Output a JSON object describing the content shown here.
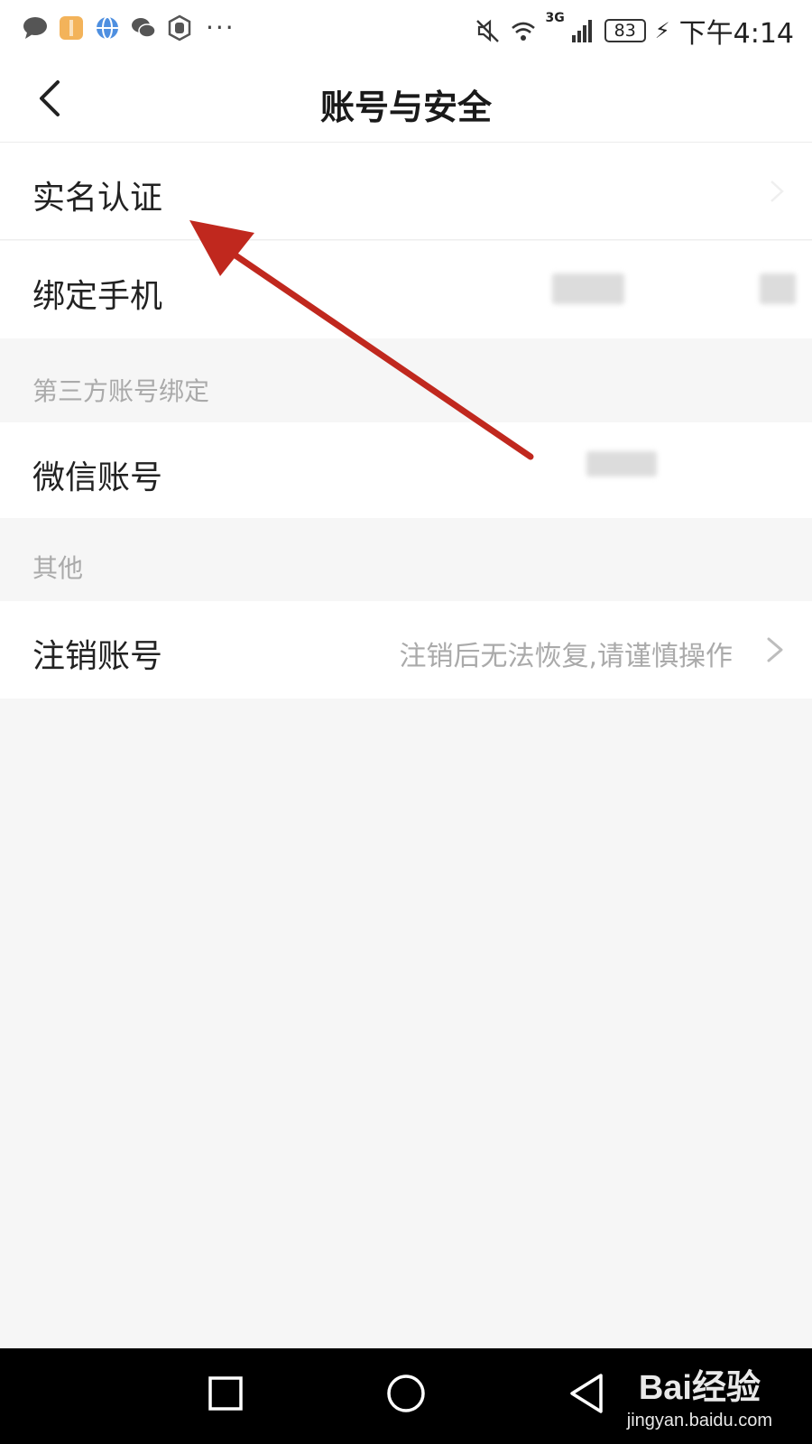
{
  "status_bar": {
    "time": "下午4:14",
    "battery": "83",
    "network": "3G",
    "more": "···"
  },
  "nav": {
    "title": "账号与安全"
  },
  "rows": {
    "realname": {
      "label": "实名认证"
    },
    "phone": {
      "label": "绑定手机"
    },
    "wechat": {
      "label": "微信账号"
    },
    "cancel": {
      "label": "注销账号",
      "hint": "注销后无法恢复,请谨慎操作"
    }
  },
  "sections": {
    "third_party": "第三方账号绑定",
    "other": "其他"
  },
  "watermark": {
    "logo": "Bai经验",
    "url": "jingyan.baidu.com"
  },
  "colors": {
    "background": "#f6f6f6",
    "card": "#ffffff",
    "annotation_arrow": "#c0281e",
    "hint_text": "#aaaaaa"
  }
}
